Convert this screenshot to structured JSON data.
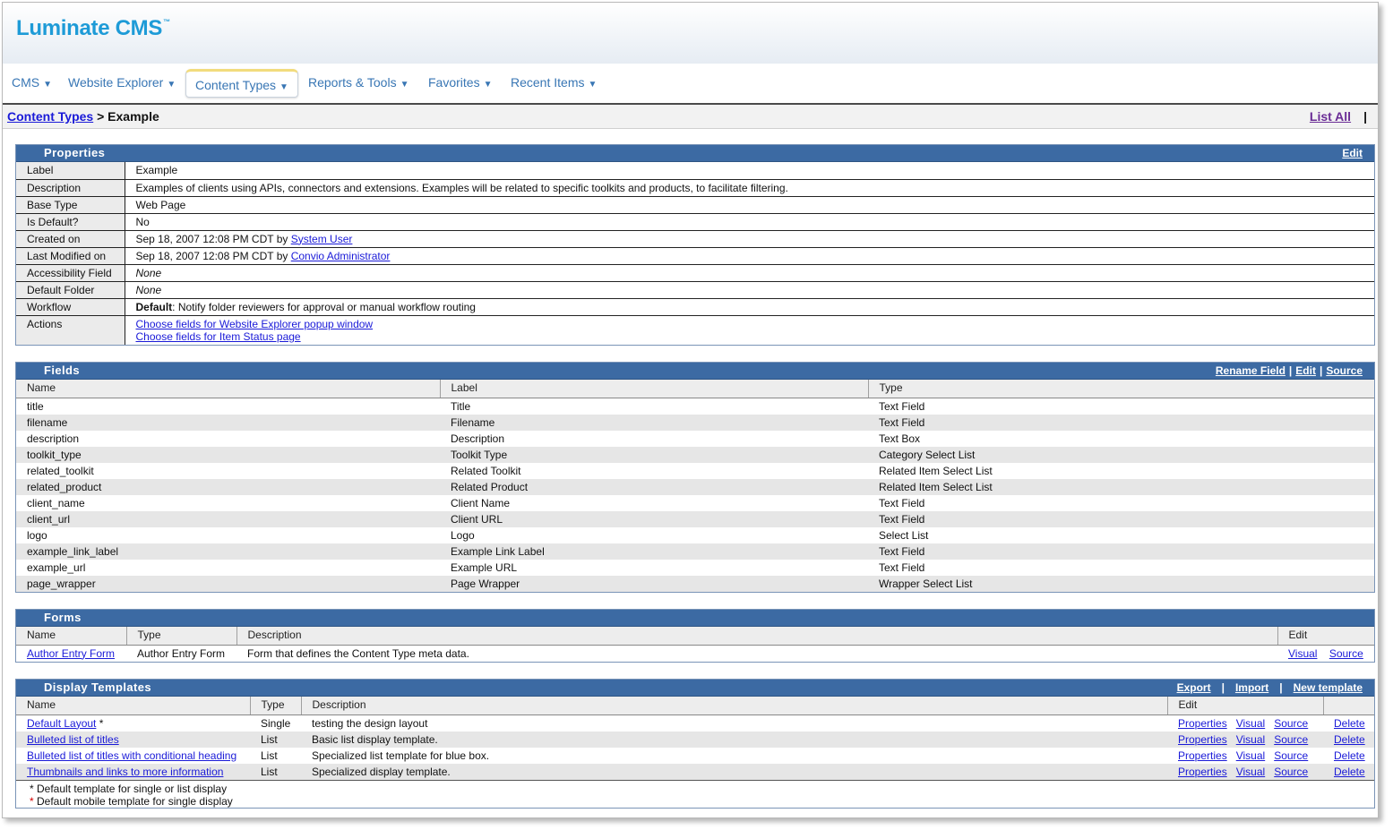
{
  "app": {
    "logo": "Luminate CMS",
    "trademark": "™"
  },
  "nav": [
    {
      "label": "CMS"
    },
    {
      "label": "Website Explorer"
    },
    {
      "label": "Content Types"
    },
    {
      "label": "Reports & Tools"
    },
    {
      "label": "Favorites"
    },
    {
      "label": "Recent Items"
    }
  ],
  "breadcrumb": {
    "link": "Content Types",
    "separator": ">",
    "current": "Example"
  },
  "list_all": {
    "label": "List All",
    "bar": "|"
  },
  "properties": {
    "title": "Properties",
    "edit": "Edit",
    "rows": [
      {
        "key": "Label",
        "value": "Example"
      },
      {
        "key": "Description",
        "value": "Examples of clients using APIs, connectors and extensions. Examples will be related to specific toolkits and products, to facilitate filtering."
      },
      {
        "key": "Base Type",
        "value": "Web Page"
      },
      {
        "key": "Is Default?",
        "value": "No"
      },
      {
        "key": "Created on",
        "value": "Sep 18, 2007 12:08 PM CDT by ",
        "link": "System User"
      },
      {
        "key": "Last Modified on",
        "value": "Sep 18, 2007 12:08 PM CDT by ",
        "link": "Convio Administrator"
      },
      {
        "key": "Accessibility Field",
        "value": "None"
      },
      {
        "key": "Default Folder",
        "value": "None"
      },
      {
        "key": "Workflow",
        "bold": "Default",
        "value": ": Notify folder reviewers for approval or manual workflow routing"
      },
      {
        "key": "Actions",
        "link1": "Choose fields for Website Explorer popup window",
        "link2": "Choose fields for Item Status page"
      }
    ]
  },
  "fields": {
    "title": "Fields",
    "actions": [
      "Rename Field",
      "Edit",
      "Source"
    ],
    "separator": "|",
    "columns": [
      "Name",
      "Label",
      "Type"
    ],
    "rows": [
      [
        "title",
        "Title",
        "Text Field"
      ],
      [
        "filename",
        "Filename",
        "Text Field"
      ],
      [
        "description",
        "Description",
        "Text Box"
      ],
      [
        "toolkit_type",
        "Toolkit Type",
        "Category Select List"
      ],
      [
        "related_toolkit",
        "Related Toolkit",
        "Related Item Select List"
      ],
      [
        "related_product",
        "Related Product",
        "Related Item Select List"
      ],
      [
        "client_name",
        "Client Name",
        "Text Field"
      ],
      [
        "client_url",
        "Client URL",
        "Text Field"
      ],
      [
        "logo",
        "Logo",
        "Select List"
      ],
      [
        "example_link_label",
        "Example Link Label",
        "Text Field"
      ],
      [
        "example_url",
        "Example URL",
        "Text Field"
      ],
      [
        "page_wrapper",
        "Page Wrapper",
        "Wrapper Select List"
      ]
    ]
  },
  "forms": {
    "title": "Forms",
    "columns": [
      "Name",
      "Type",
      "Description",
      "Edit"
    ],
    "rows": [
      {
        "name": "Author Entry Form",
        "type": "Author Entry Form",
        "description": "Form that defines the Content Type meta data.",
        "visual": "Visual",
        "source": "Source"
      }
    ]
  },
  "templates": {
    "title": "Display Templates",
    "actions": [
      "Export",
      "Import",
      "New template"
    ],
    "separator": "|",
    "columns": [
      "Name",
      "Type",
      "Description",
      "Edit"
    ],
    "rows": [
      {
        "name": "Default Layout",
        "marker": " *",
        "type": "Single",
        "description": "testing the design layout"
      },
      {
        "name": "Bulleted list of titles",
        "marker": "",
        "type": "List",
        "description": "Basic list display template."
      },
      {
        "name": "Bulleted list of titles with conditional heading",
        "marker": "",
        "type": "List",
        "description": "Specialized list template for blue box."
      },
      {
        "name": "Thumbnails and links to more information",
        "marker": "",
        "type": "List",
        "description": "Specialized display template."
      }
    ],
    "row_actions": [
      "Properties",
      "Visual",
      "Source",
      "Delete"
    ],
    "notes": [
      {
        "star": "*",
        "text": " Default template for single or list display"
      },
      {
        "star": "*",
        "text": " Default mobile template for single display"
      }
    ]
  }
}
